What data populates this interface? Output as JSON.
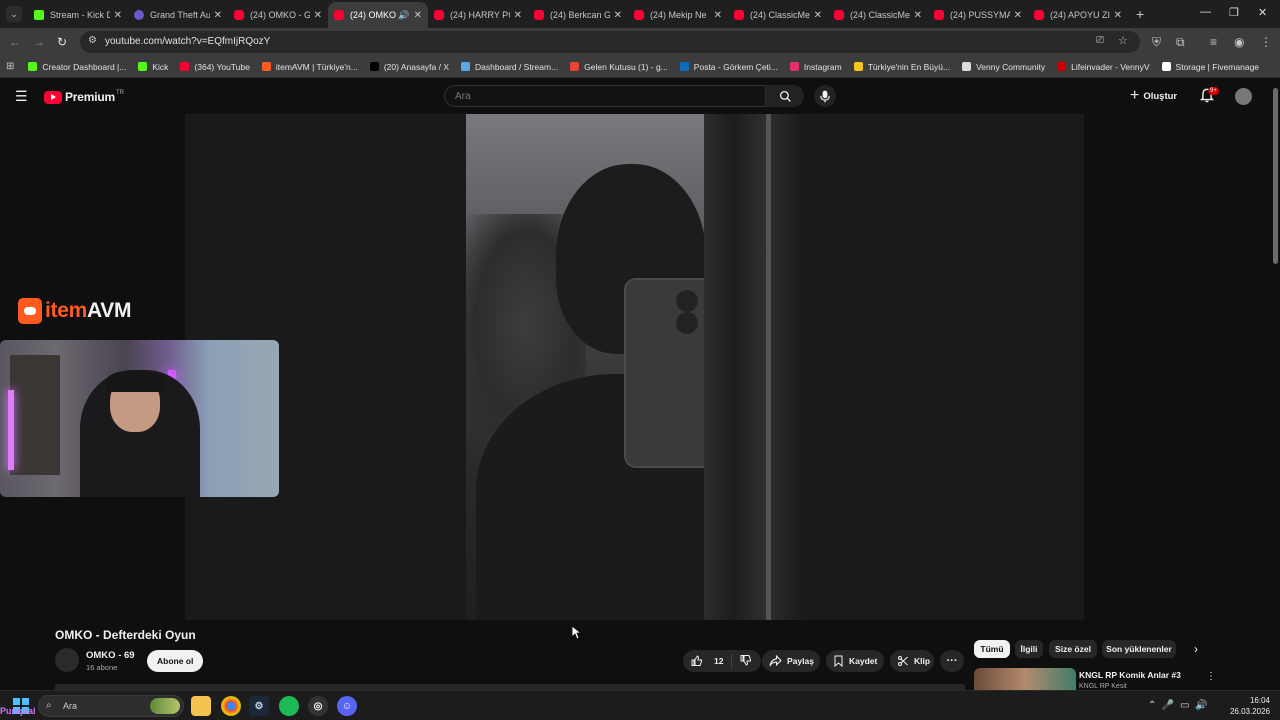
{
  "browser": {
    "tabs": [
      {
        "title": "Stream - Kick D",
        "icon": "kick",
        "active": false
      },
      {
        "title": "Grand Theft Au",
        "icon": "g",
        "active": false
      },
      {
        "title": "(24) OMKO - G",
        "icon": "youtube",
        "active": false
      },
      {
        "title": "(24) OMKO",
        "icon": "youtube",
        "active": true
      },
      {
        "title": "(24) HARRY PO",
        "icon": "youtube",
        "active": false
      },
      {
        "title": "(24) Berkcan G",
        "icon": "youtube",
        "active": false
      },
      {
        "title": "(24) Mekip Ne",
        "icon": "youtube",
        "active": false
      },
      {
        "title": "(24) ClassicMe",
        "icon": "youtube",
        "active": false
      },
      {
        "title": "(24) ClassicMe",
        "icon": "youtube",
        "active": false
      },
      {
        "title": "(24) PUSSYMA",
        "icon": "youtube",
        "active": false
      },
      {
        "title": "(24) APOYU ZI",
        "icon": "youtube",
        "active": false
      }
    ],
    "url": "youtube.com/watch?v=EQfmIjRQozY",
    "bookmarks": [
      {
        "label": "Creator Dashboard |...",
        "color": "#53fc18"
      },
      {
        "label": "Kick",
        "color": "#53fc18"
      },
      {
        "label": "(364) YouTube",
        "color": "#ff0033"
      },
      {
        "label": "itemAVM | Türkiye'n...",
        "color": "#ff5a1f"
      },
      {
        "label": "(20) Anasayfa / X",
        "color": "#000000"
      },
      {
        "label": "Dashboard / Stream...",
        "color": "#5aa9e6"
      },
      {
        "label": "Gelen Kutusu (1) - g...",
        "color": "#ea4335"
      },
      {
        "label": "Posta - Görkem Çeti...",
        "color": "#0f6cbd"
      },
      {
        "label": "Instagram",
        "color": "#e1306c"
      },
      {
        "label": "Türkiye'nin En Büyü...",
        "color": "#f5c518"
      },
      {
        "label": "Venny Community",
        "color": "#dddddd"
      },
      {
        "label": "Lifeinvader - VennyV",
        "color": "#cc0000"
      },
      {
        "label": "Storage | Fivemanage",
        "color": "#ffffff"
      }
    ]
  },
  "youtube": {
    "logo_text": "Premium",
    "logo_region": "TR",
    "search_placeholder": "Ara",
    "create_label": "Oluştur",
    "notifications_badge": "9+",
    "video": {
      "title": "OMKO - Defterdeki Oyun",
      "channel": "OMKO - 69",
      "subscribers": "16 abone",
      "subscribe_label": "Abone ol",
      "likes": "12",
      "share_label": "Paylaş",
      "save_label": "Kaydet",
      "clip_label": "Klip",
      "more_label": "···"
    },
    "overlay_brand": {
      "part1": "item",
      "part2": "AVM"
    },
    "chips": [
      "Tümü",
      "İlgili",
      "Size özel",
      "Son yüklenenler"
    ],
    "recommendation": {
      "title": "KNGL RP Komik Anlar #3",
      "channel": "KNGL RP Kesit"
    }
  },
  "taskbar": {
    "search_label": "Ara",
    "overlay_text": "Punqual",
    "time": "16:04",
    "date": "26.03.2026"
  }
}
